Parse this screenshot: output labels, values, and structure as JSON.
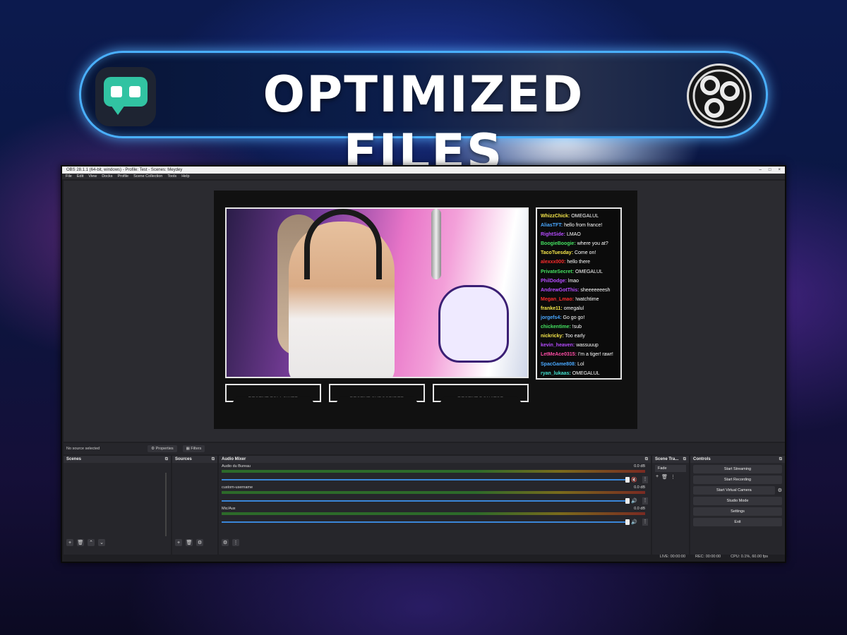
{
  "banner": {
    "title": "OPTIMIZED FILES",
    "left_logo": "streamlabs-logo",
    "right_logo": "obs-logo"
  },
  "window": {
    "title": "OBS 28.1.1 (64-bit, windows) - Profile: Test - Scenes: Meydey",
    "controls": [
      "–",
      "□",
      "×"
    ]
  },
  "menu": [
    "File",
    "Edit",
    "View",
    "Docks",
    "Profile",
    "Scene Collection",
    "Tools",
    "Help"
  ],
  "preview": {
    "alerts": [
      "RECENT FOLLOWER",
      "RECENT SUBSCRIBER",
      "RECENT DONATOR"
    ],
    "chat": [
      {
        "user": "WhizzChick:",
        "msg": "OMEGALUL",
        "color": "#f5e64a"
      },
      {
        "user": "AliasTFT:",
        "msg": "hello from france!",
        "color": "#49a8ff"
      },
      {
        "user": "RightSide:",
        "msg": "LMAO",
        "color": "#b64cff"
      },
      {
        "user": "BoogieBoogie:",
        "msg": "where you at?",
        "color": "#44e060"
      },
      {
        "user": "TacoTuesday:",
        "msg": "Come on!",
        "color": "#f5e64a"
      },
      {
        "user": "alexxx000:",
        "msg": "hello there",
        "color": "#ff2c2c"
      },
      {
        "user": "PrivateSecret:",
        "msg": "OMEGALUL",
        "color": "#44e060"
      },
      {
        "user": "PhilDodge:",
        "msg": "lmao",
        "color": "#b64cff"
      },
      {
        "user": "AndrewGotThis:",
        "msg": "sheeeeeeesh",
        "color": "#b64cff"
      },
      {
        "user": "Megan_Lmao:",
        "msg": "!watchtime",
        "color": "#ff2c2c"
      },
      {
        "user": "franke11:",
        "msg": "omegalul",
        "color": "#f5e64a"
      },
      {
        "user": "jorgefs4:",
        "msg": "Go go go!",
        "color": "#49a8ff"
      },
      {
        "user": "chickentime:",
        "msg": "!sub",
        "color": "#44e060"
      },
      {
        "user": "nickricky:",
        "msg": "Too early",
        "color": "#f5e64a"
      },
      {
        "user": "kevin_heaven:",
        "msg": "wassuuup",
        "color": "#b64cff"
      },
      {
        "user": "LetMeAce0315:",
        "msg": "I'm a tiger! rawr!",
        "color": "#ff4da6"
      },
      {
        "user": "SpacGame808:",
        "msg": "Lol",
        "color": "#49a8ff"
      },
      {
        "user": "ryan_lukaas:",
        "msg": "OMEGALUL",
        "color": "#44e0d0"
      }
    ]
  },
  "propsbar": {
    "no_source": "No source selected",
    "properties": "Properties",
    "filters": "Filters"
  },
  "docks": {
    "scenes": "Scenes",
    "sources": "Sources",
    "mixer": "Audio Mixer",
    "transitions": "Scene Tra...",
    "controls": "Controls"
  },
  "mixer_channels": [
    {
      "name": "Audio du Bureau",
      "db": "0.0 dB"
    },
    {
      "name": "custom-username",
      "db": "0.0 dB"
    },
    {
      "name": "Mic/Aux",
      "db": "0.0 dB"
    }
  ],
  "transition_value": "Fade",
  "controls": [
    "Start Streaming",
    "Start Recording",
    "Start Virtual Camera",
    "Studio Mode",
    "Settings",
    "Exit"
  ],
  "status": {
    "live": "LIVE: 00:00:00",
    "rec": "REC: 00:00:00",
    "cpu": "CPU: 0.1%, 60.00 fps"
  }
}
